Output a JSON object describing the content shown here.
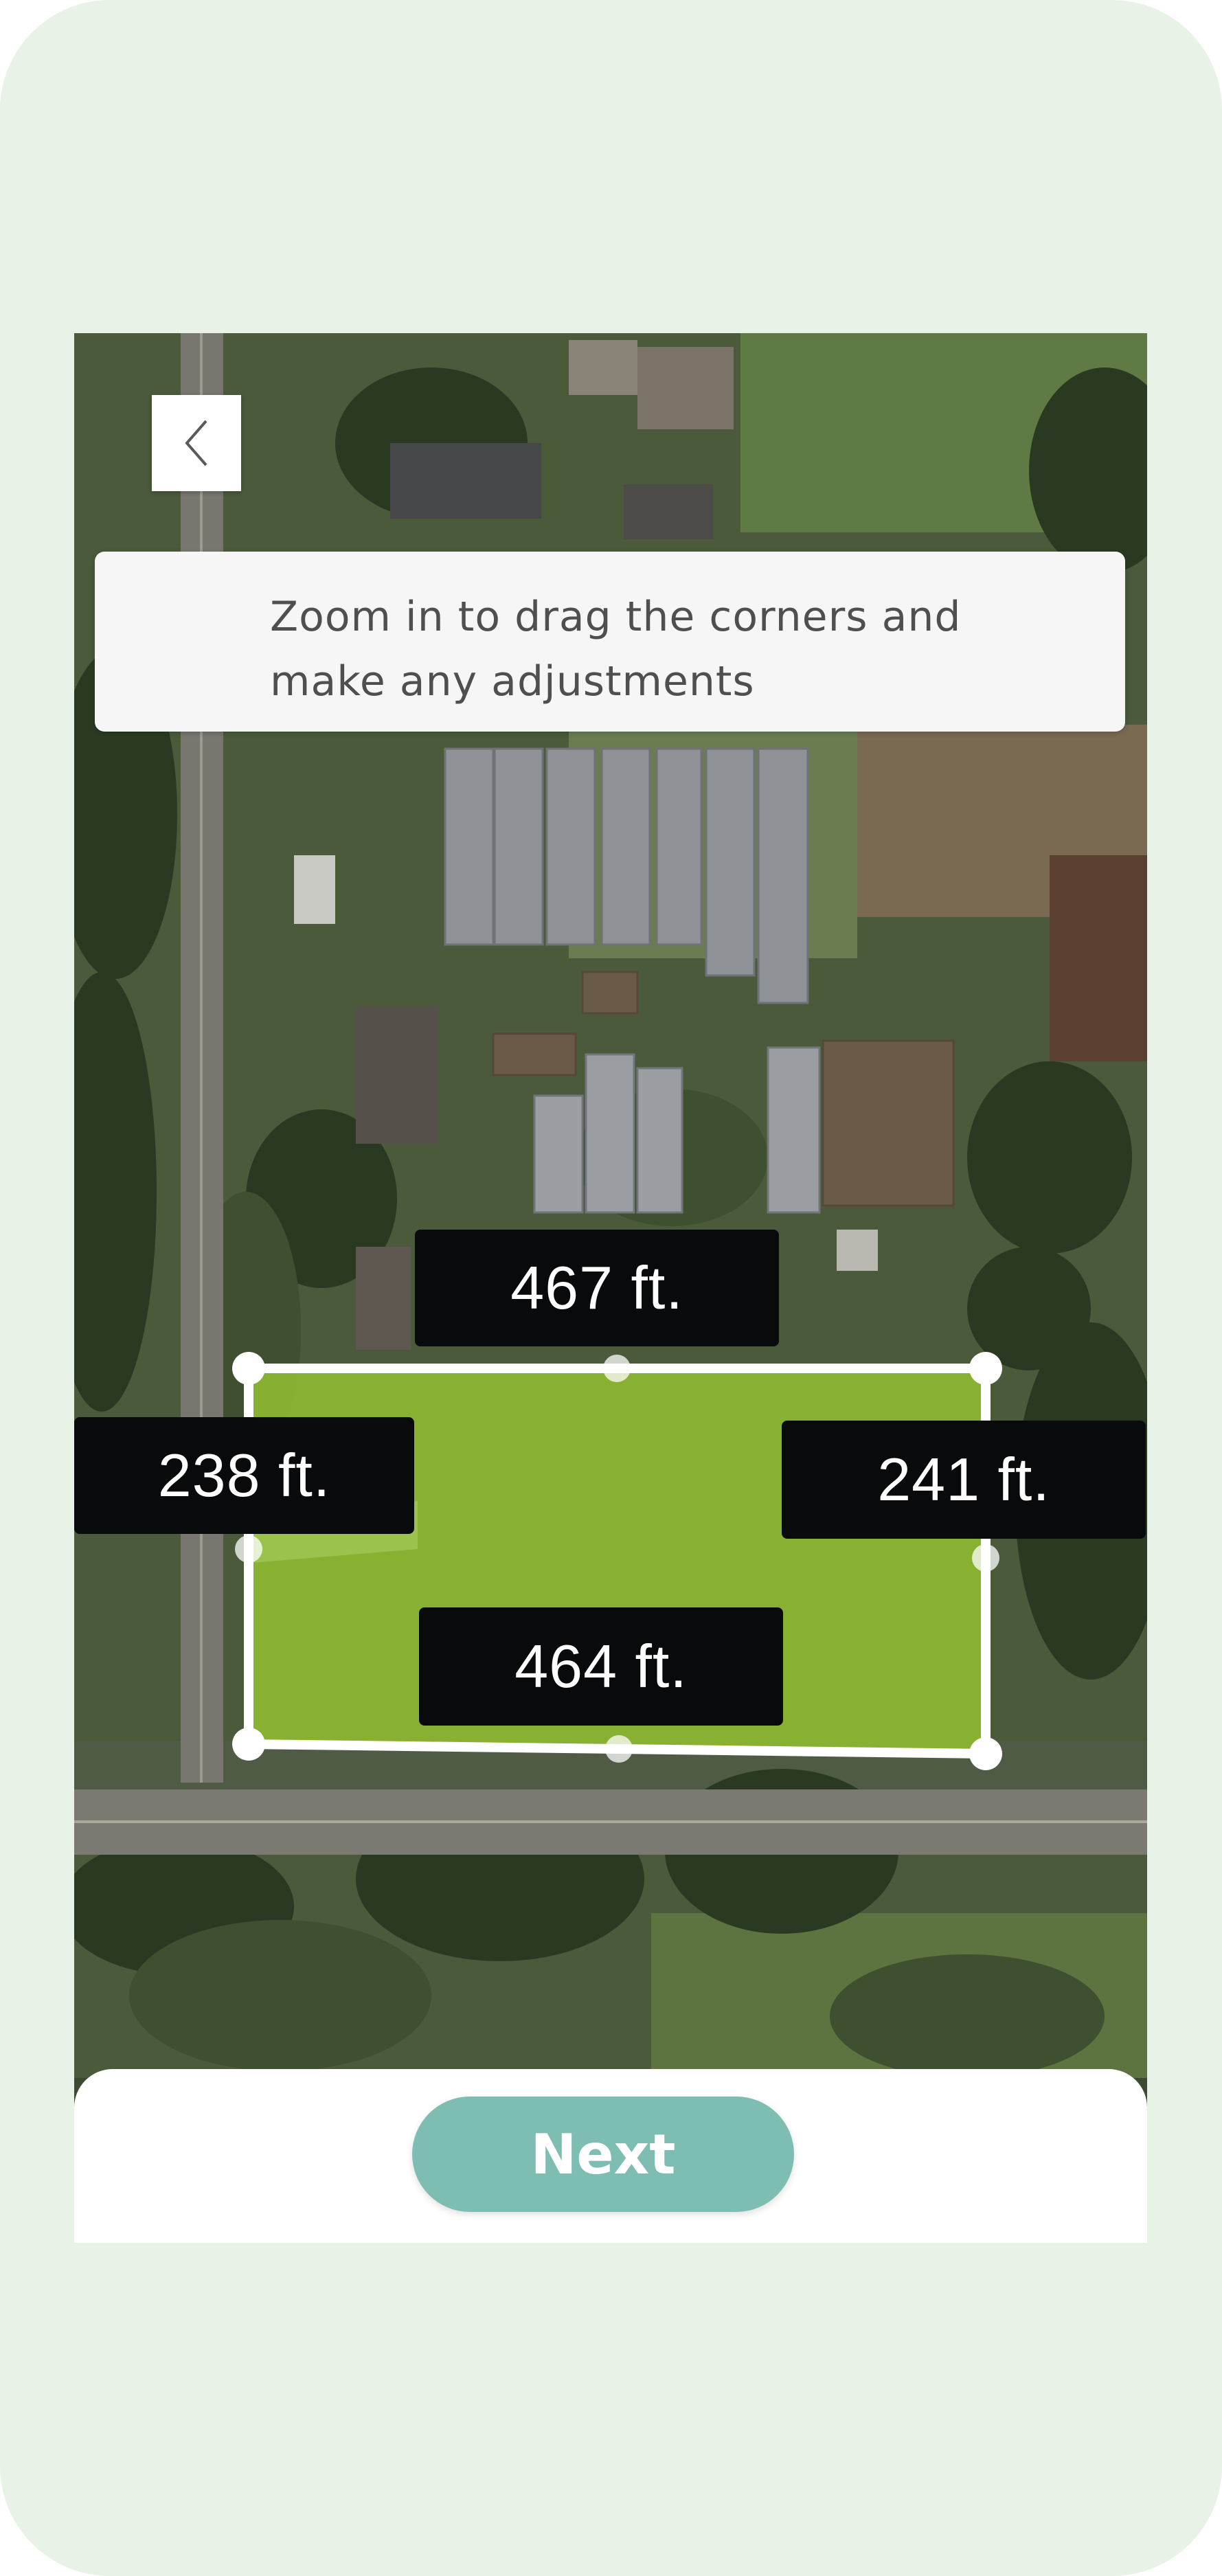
{
  "instruction": {
    "text": "Zoom in to drag the corners and make any adjustments"
  },
  "back_button": {
    "icon": "chevron-left-icon"
  },
  "plot": {
    "dimensions": {
      "top": "467 ft.",
      "left": "238 ft.",
      "right": "241 ft.",
      "bottom": "464 ft."
    },
    "fill_color": "#8db832",
    "outline_color": "#ffffff"
  },
  "next_button": {
    "label": "Next",
    "color": "#7ebdb1"
  },
  "colors": {
    "phone_background": "#e8f2e7",
    "label_background": "#080a0b"
  }
}
